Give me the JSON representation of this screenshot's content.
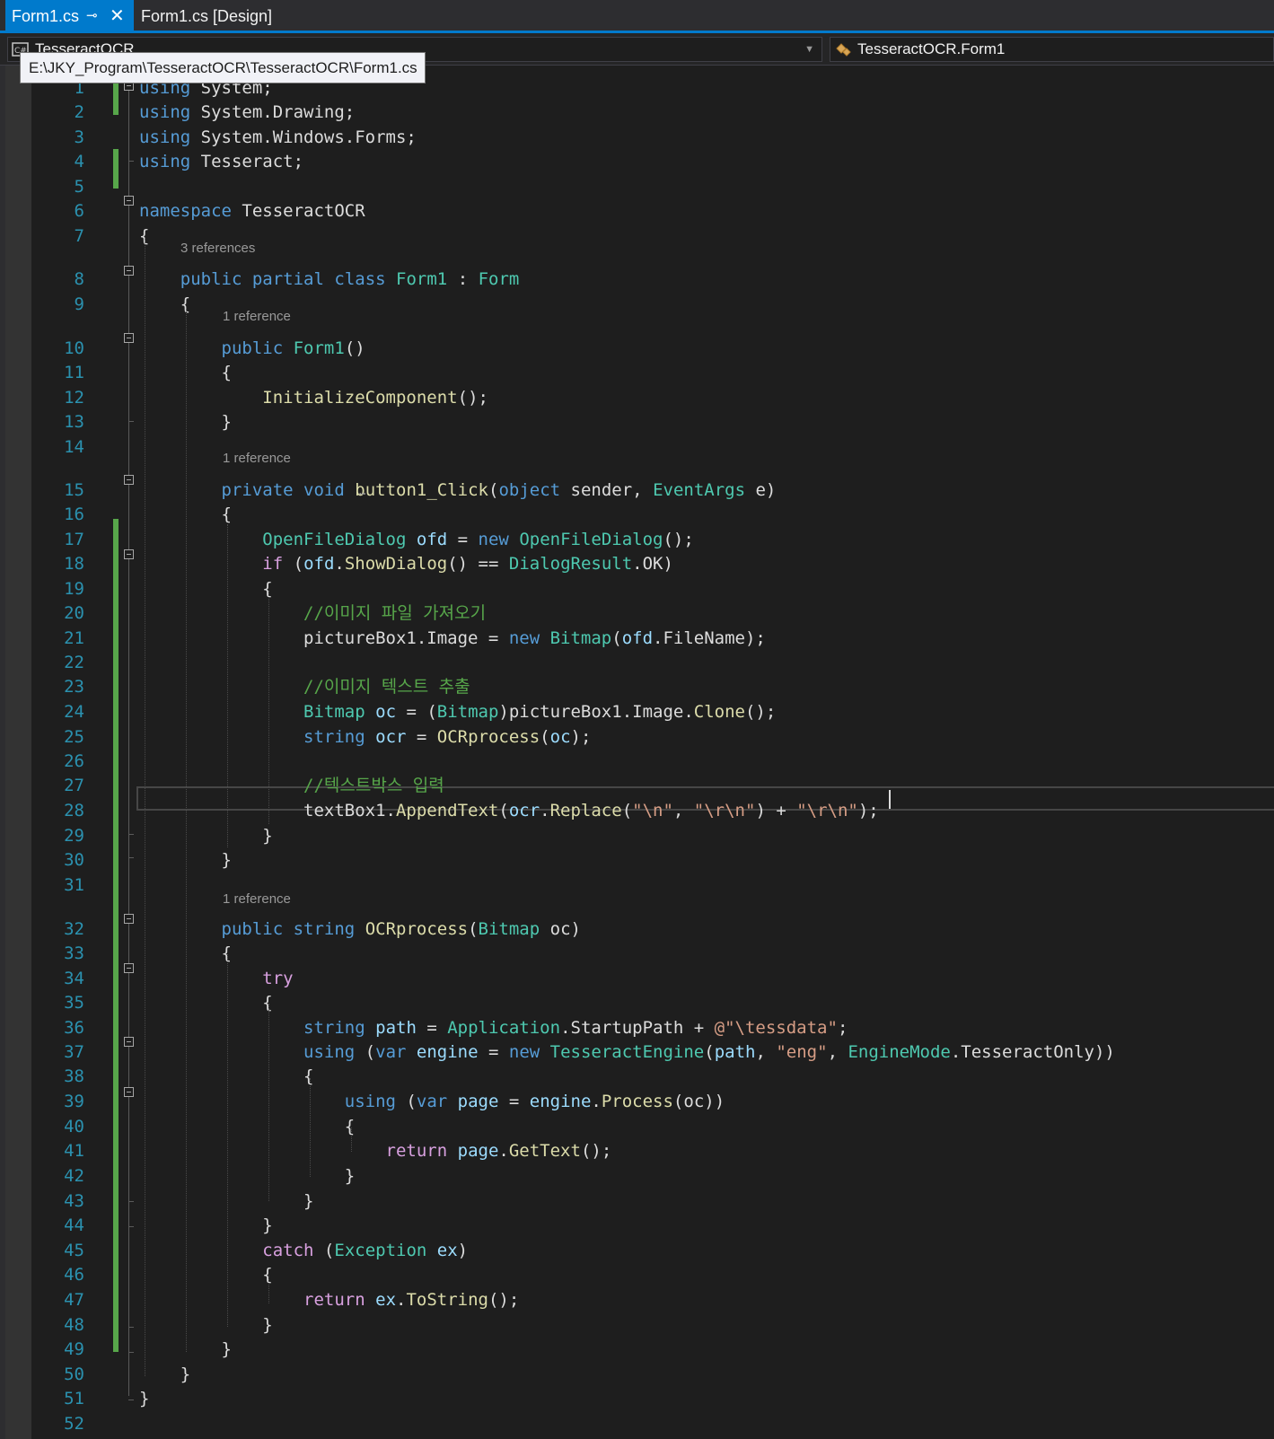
{
  "tabs": [
    {
      "label": "Form1.cs",
      "active": true
    },
    {
      "label": "Form1.cs [Design]",
      "active": false
    }
  ],
  "navbar": {
    "project": "TesseractOCR",
    "type": "TesseractOCR.Form1"
  },
  "tooltip": "E:\\JKY_Program\\TesseractOCR\\TesseractOCR\\Form1.cs",
  "codelens": {
    "class_refs": "3 references",
    "ctor_refs": "1 reference",
    "click_refs": "1 reference",
    "ocr_refs": "1 reference"
  },
  "lines": [
    {
      "n": "1",
      "tokens": [
        {
          "t": "using",
          "c": "kw"
        },
        {
          "t": " System;",
          "c": "pl"
        }
      ]
    },
    {
      "n": "2",
      "tokens": [
        {
          "t": "using",
          "c": "kw"
        },
        {
          "t": " System.Drawing;",
          "c": "pl"
        }
      ]
    },
    {
      "n": "3",
      "tokens": [
        {
          "t": "using",
          "c": "kw"
        },
        {
          "t": " System.Windows.Forms;",
          "c": "pl"
        }
      ]
    },
    {
      "n": "4",
      "tokens": [
        {
          "t": "using",
          "c": "kw"
        },
        {
          "t": " Tesseract;",
          "c": "pl"
        }
      ]
    },
    {
      "n": "5",
      "tokens": []
    },
    {
      "n": "6",
      "tokens": [
        {
          "t": "namespace",
          "c": "kw"
        },
        {
          "t": " TesseractOCR",
          "c": "pl"
        }
      ]
    },
    {
      "n": "7",
      "tokens": [
        {
          "t": "{",
          "c": "pl"
        }
      ]
    },
    {
      "n": "8",
      "tokens": [
        {
          "t": "    ",
          "c": "pl"
        },
        {
          "t": "public",
          "c": "kw"
        },
        {
          "t": " ",
          "c": "pl"
        },
        {
          "t": "partial",
          "c": "kw"
        },
        {
          "t": " ",
          "c": "pl"
        },
        {
          "t": "class",
          "c": "kw"
        },
        {
          "t": " ",
          "c": "pl"
        },
        {
          "t": "Form1",
          "c": "ty"
        },
        {
          "t": " : ",
          "c": "pl"
        },
        {
          "t": "Form",
          "c": "ty"
        }
      ]
    },
    {
      "n": "9",
      "tokens": [
        {
          "t": "    {",
          "c": "pl"
        }
      ]
    },
    {
      "n": "10",
      "tokens": [
        {
          "t": "        ",
          "c": "pl"
        },
        {
          "t": "public",
          "c": "kw"
        },
        {
          "t": " ",
          "c": "pl"
        },
        {
          "t": "Form1",
          "c": "ty"
        },
        {
          "t": "()",
          "c": "pl"
        }
      ]
    },
    {
      "n": "11",
      "tokens": [
        {
          "t": "        {",
          "c": "pl"
        }
      ]
    },
    {
      "n": "12",
      "tokens": [
        {
          "t": "            ",
          "c": "pl"
        },
        {
          "t": "InitializeComponent",
          "c": "mt"
        },
        {
          "t": "();",
          "c": "pl"
        }
      ]
    },
    {
      "n": "13",
      "tokens": [
        {
          "t": "        }",
          "c": "pl"
        }
      ]
    },
    {
      "n": "14",
      "tokens": []
    },
    {
      "n": "15",
      "tokens": [
        {
          "t": "        ",
          "c": "pl"
        },
        {
          "t": "private",
          "c": "kw"
        },
        {
          "t": " ",
          "c": "pl"
        },
        {
          "t": "void",
          "c": "kw"
        },
        {
          "t": " ",
          "c": "pl"
        },
        {
          "t": "button1_Click",
          "c": "mt"
        },
        {
          "t": "(",
          "c": "pl"
        },
        {
          "t": "object",
          "c": "kw"
        },
        {
          "t": " ",
          "c": "pl"
        },
        {
          "t": "sender",
          "c": "pm"
        },
        {
          "t": ", ",
          "c": "pl"
        },
        {
          "t": "EventArgs",
          "c": "ty"
        },
        {
          "t": " ",
          "c": "pl"
        },
        {
          "t": "e",
          "c": "pm"
        },
        {
          "t": ")",
          "c": "pl"
        }
      ]
    },
    {
      "n": "16",
      "tokens": [
        {
          "t": "        {",
          "c": "pl"
        }
      ]
    },
    {
      "n": "17",
      "tokens": [
        {
          "t": "            ",
          "c": "pl"
        },
        {
          "t": "OpenFileDialog",
          "c": "ty"
        },
        {
          "t": " ",
          "c": "pl"
        },
        {
          "t": "ofd",
          "c": "va"
        },
        {
          "t": " = ",
          "c": "pl"
        },
        {
          "t": "new",
          "c": "kw"
        },
        {
          "t": " ",
          "c": "pl"
        },
        {
          "t": "OpenFileDialog",
          "c": "ty"
        },
        {
          "t": "();",
          "c": "pl"
        }
      ]
    },
    {
      "n": "18",
      "tokens": [
        {
          "t": "            ",
          "c": "pl"
        },
        {
          "t": "if",
          "c": "kc"
        },
        {
          "t": " (",
          "c": "pl"
        },
        {
          "t": "ofd",
          "c": "va"
        },
        {
          "t": ".",
          "c": "pl"
        },
        {
          "t": "ShowDialog",
          "c": "mt"
        },
        {
          "t": "() == ",
          "c": "pl"
        },
        {
          "t": "DialogResult",
          "c": "ty"
        },
        {
          "t": ".OK)",
          "c": "pl"
        }
      ]
    },
    {
      "n": "19",
      "tokens": [
        {
          "t": "            {",
          "c": "pl"
        }
      ]
    },
    {
      "n": "20",
      "tokens": [
        {
          "t": "                ",
          "c": "pl"
        },
        {
          "t": "//이미지 파일 가져오기",
          "c": "cm"
        }
      ]
    },
    {
      "n": "21",
      "tokens": [
        {
          "t": "                pictureBox1.Image = ",
          "c": "pl"
        },
        {
          "t": "new",
          "c": "kw"
        },
        {
          "t": " ",
          "c": "pl"
        },
        {
          "t": "Bitmap",
          "c": "ty"
        },
        {
          "t": "(",
          "c": "pl"
        },
        {
          "t": "ofd",
          "c": "va"
        },
        {
          "t": ".FileName);",
          "c": "pl"
        }
      ]
    },
    {
      "n": "22",
      "tokens": []
    },
    {
      "n": "23",
      "tokens": [
        {
          "t": "                ",
          "c": "pl"
        },
        {
          "t": "//이미지 텍스트 추출",
          "c": "cm"
        }
      ]
    },
    {
      "n": "24",
      "tokens": [
        {
          "t": "                ",
          "c": "pl"
        },
        {
          "t": "Bitmap",
          "c": "ty"
        },
        {
          "t": " ",
          "c": "pl"
        },
        {
          "t": "oc",
          "c": "va"
        },
        {
          "t": " = (",
          "c": "pl"
        },
        {
          "t": "Bitmap",
          "c": "ty"
        },
        {
          "t": ")pictureBox1.Image.",
          "c": "pl"
        },
        {
          "t": "Clone",
          "c": "mt"
        },
        {
          "t": "();",
          "c": "pl"
        }
      ]
    },
    {
      "n": "25",
      "tokens": [
        {
          "t": "                ",
          "c": "pl"
        },
        {
          "t": "string",
          "c": "kw"
        },
        {
          "t": " ",
          "c": "pl"
        },
        {
          "t": "ocr",
          "c": "va"
        },
        {
          "t": " = ",
          "c": "pl"
        },
        {
          "t": "OCRprocess",
          "c": "mt"
        },
        {
          "t": "(",
          "c": "pl"
        },
        {
          "t": "oc",
          "c": "va"
        },
        {
          "t": ");",
          "c": "pl"
        }
      ]
    },
    {
      "n": "26",
      "tokens": []
    },
    {
      "n": "27",
      "tokens": [
        {
          "t": "                ",
          "c": "pl"
        },
        {
          "t": "//텍스트박스 입력",
          "c": "cm"
        }
      ]
    },
    {
      "n": "28",
      "tokens": [
        {
          "t": "                textBox1.",
          "c": "pl"
        },
        {
          "t": "AppendText",
          "c": "mt"
        },
        {
          "t": "(",
          "c": "pl"
        },
        {
          "t": "ocr",
          "c": "va"
        },
        {
          "t": ".",
          "c": "pl"
        },
        {
          "t": "Replace",
          "c": "mt"
        },
        {
          "t": "(",
          "c": "pl"
        },
        {
          "t": "\"\\n\"",
          "c": "st"
        },
        {
          "t": ", ",
          "c": "pl"
        },
        {
          "t": "\"\\r\\n\"",
          "c": "st"
        },
        {
          "t": ") + ",
          "c": "pl"
        },
        {
          "t": "\"\\r\\n\"",
          "c": "st"
        },
        {
          "t": ");",
          "c": "pl"
        }
      ]
    },
    {
      "n": "29",
      "tokens": [
        {
          "t": "            }",
          "c": "pl"
        }
      ]
    },
    {
      "n": "30",
      "tokens": [
        {
          "t": "        }",
          "c": "pl"
        }
      ]
    },
    {
      "n": "31",
      "tokens": []
    },
    {
      "n": "32",
      "tokens": [
        {
          "t": "        ",
          "c": "pl"
        },
        {
          "t": "public",
          "c": "kw"
        },
        {
          "t": " ",
          "c": "pl"
        },
        {
          "t": "string",
          "c": "kw"
        },
        {
          "t": " ",
          "c": "pl"
        },
        {
          "t": "OCRprocess",
          "c": "mt"
        },
        {
          "t": "(",
          "c": "pl"
        },
        {
          "t": "Bitmap",
          "c": "ty"
        },
        {
          "t": " ",
          "c": "pl"
        },
        {
          "t": "oc",
          "c": "pm"
        },
        {
          "t": ")",
          "c": "pl"
        }
      ]
    },
    {
      "n": "33",
      "tokens": [
        {
          "t": "        {",
          "c": "pl"
        }
      ]
    },
    {
      "n": "34",
      "tokens": [
        {
          "t": "            ",
          "c": "pl"
        },
        {
          "t": "try",
          "c": "kc"
        }
      ]
    },
    {
      "n": "35",
      "tokens": [
        {
          "t": "            {",
          "c": "pl"
        }
      ]
    },
    {
      "n": "36",
      "tokens": [
        {
          "t": "                ",
          "c": "pl"
        },
        {
          "t": "string",
          "c": "kw"
        },
        {
          "t": " ",
          "c": "pl"
        },
        {
          "t": "path",
          "c": "va"
        },
        {
          "t": " = ",
          "c": "pl"
        },
        {
          "t": "Application",
          "c": "ty"
        },
        {
          "t": ".StartupPath + ",
          "c": "pl"
        },
        {
          "t": "@\"\\tessdata\"",
          "c": "st"
        },
        {
          "t": ";",
          "c": "pl"
        }
      ]
    },
    {
      "n": "37",
      "tokens": [
        {
          "t": "                ",
          "c": "pl"
        },
        {
          "t": "using",
          "c": "kw"
        },
        {
          "t": " (",
          "c": "pl"
        },
        {
          "t": "var",
          "c": "kw"
        },
        {
          "t": " ",
          "c": "pl"
        },
        {
          "t": "engine",
          "c": "va"
        },
        {
          "t": " = ",
          "c": "pl"
        },
        {
          "t": "new",
          "c": "kw"
        },
        {
          "t": " ",
          "c": "pl"
        },
        {
          "t": "TesseractEngine",
          "c": "ty"
        },
        {
          "t": "(",
          "c": "pl"
        },
        {
          "t": "path",
          "c": "va"
        },
        {
          "t": ", ",
          "c": "pl"
        },
        {
          "t": "\"eng\"",
          "c": "st"
        },
        {
          "t": ", ",
          "c": "pl"
        },
        {
          "t": "EngineMode",
          "c": "ty"
        },
        {
          "t": ".TesseractOnly))",
          "c": "pl"
        }
      ]
    },
    {
      "n": "38",
      "tokens": [
        {
          "t": "                {",
          "c": "pl"
        }
      ]
    },
    {
      "n": "39",
      "tokens": [
        {
          "t": "                    ",
          "c": "pl"
        },
        {
          "t": "using",
          "c": "kw"
        },
        {
          "t": " (",
          "c": "pl"
        },
        {
          "t": "var",
          "c": "kw"
        },
        {
          "t": " ",
          "c": "pl"
        },
        {
          "t": "page",
          "c": "va"
        },
        {
          "t": " = ",
          "c": "pl"
        },
        {
          "t": "engine",
          "c": "va"
        },
        {
          "t": ".",
          "c": "pl"
        },
        {
          "t": "Process",
          "c": "mt"
        },
        {
          "t": "(",
          "c": "pl"
        },
        {
          "t": "oc",
          "c": "pm"
        },
        {
          "t": "))",
          "c": "pl"
        }
      ]
    },
    {
      "n": "40",
      "tokens": [
        {
          "t": "                    {",
          "c": "pl"
        }
      ]
    },
    {
      "n": "41",
      "tokens": [
        {
          "t": "                        ",
          "c": "pl"
        },
        {
          "t": "return",
          "c": "kc"
        },
        {
          "t": " ",
          "c": "pl"
        },
        {
          "t": "page",
          "c": "va"
        },
        {
          "t": ".",
          "c": "pl"
        },
        {
          "t": "GetText",
          "c": "mt"
        },
        {
          "t": "();",
          "c": "pl"
        }
      ]
    },
    {
      "n": "42",
      "tokens": [
        {
          "t": "                    }",
          "c": "pl"
        }
      ]
    },
    {
      "n": "43",
      "tokens": [
        {
          "t": "                }",
          "c": "pl"
        }
      ]
    },
    {
      "n": "44",
      "tokens": [
        {
          "t": "            }",
          "c": "pl"
        }
      ]
    },
    {
      "n": "45",
      "tokens": [
        {
          "t": "            ",
          "c": "pl"
        },
        {
          "t": "catch",
          "c": "kc"
        },
        {
          "t": " (",
          "c": "pl"
        },
        {
          "t": "Exception",
          "c": "ty"
        },
        {
          "t": " ",
          "c": "pl"
        },
        {
          "t": "ex",
          "c": "va"
        },
        {
          "t": ")",
          "c": "pl"
        }
      ]
    },
    {
      "n": "46",
      "tokens": [
        {
          "t": "            {",
          "c": "pl"
        }
      ]
    },
    {
      "n": "47",
      "tokens": [
        {
          "t": "                ",
          "c": "pl"
        },
        {
          "t": "return",
          "c": "kc"
        },
        {
          "t": " ",
          "c": "pl"
        },
        {
          "t": "ex",
          "c": "va"
        },
        {
          "t": ".",
          "c": "pl"
        },
        {
          "t": "ToString",
          "c": "mt"
        },
        {
          "t": "();",
          "c": "pl"
        }
      ]
    },
    {
      "n": "48",
      "tokens": [
        {
          "t": "            }",
          "c": "pl"
        }
      ]
    },
    {
      "n": "49",
      "tokens": [
        {
          "t": "        }",
          "c": "pl"
        }
      ]
    },
    {
      "n": "50",
      "tokens": [
        {
          "t": "    }",
          "c": "pl"
        }
      ]
    },
    {
      "n": "51",
      "tokens": [
        {
          "t": "}",
          "c": "pl"
        }
      ]
    },
    {
      "n": "52",
      "tokens": []
    }
  ],
  "colors": {
    "accent": "#007acc",
    "background": "#1e1e1e",
    "keyword": "#569cd6",
    "control": "#d8a0df",
    "type": "#4ec9b0",
    "method": "#dcdcaa",
    "variable": "#9cdcfe",
    "string": "#d69d85",
    "comment": "#57a64a",
    "line_number": "#2b91af"
  }
}
